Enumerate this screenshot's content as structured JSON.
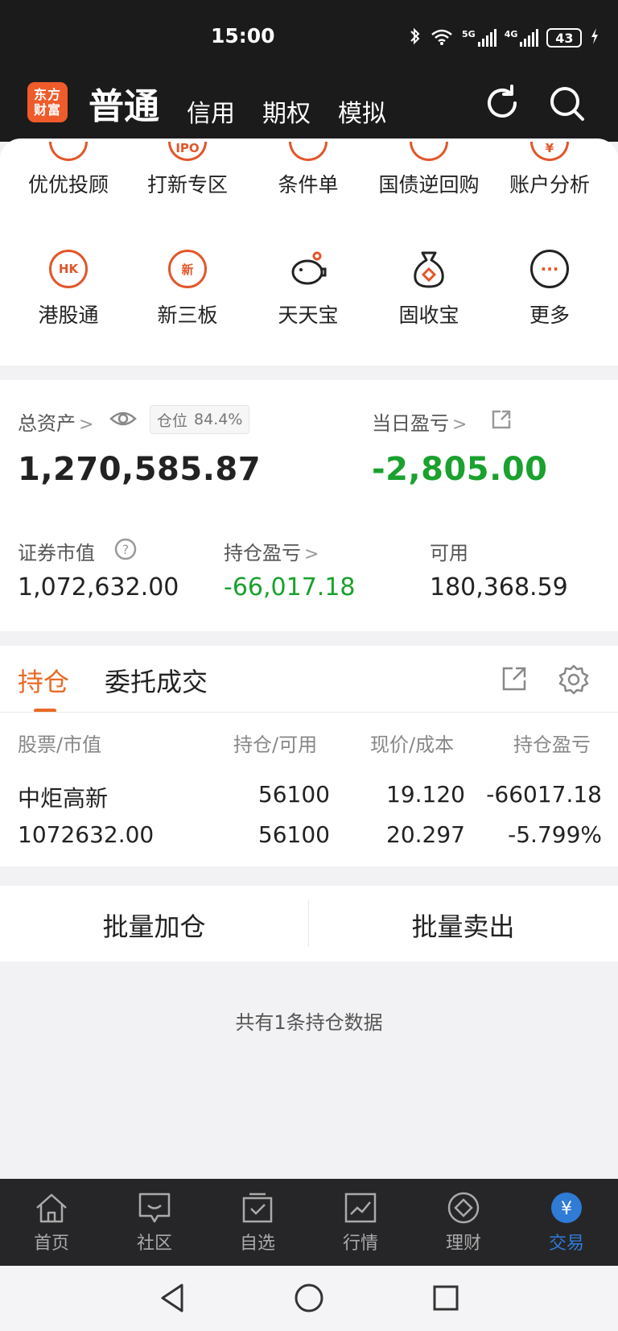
{
  "status_bar": {
    "time": "15:00",
    "battery": "43",
    "sig1": "5G",
    "sig2": "4G"
  },
  "header": {
    "logo_line1": "东方",
    "logo_line2": "财富",
    "tabs": [
      "普通",
      "信用",
      "期权",
      "模拟"
    ],
    "active_tab": "普通"
  },
  "quick_grid": {
    "row1": [
      {
        "label": "优优投顾",
        "icon": "clip-icon",
        "glyph": ""
      },
      {
        "label": "打新专区",
        "icon": "ipo-icon",
        "glyph": "IPO"
      },
      {
        "label": "条件单",
        "icon": "candlestick-icon",
        "glyph": ""
      },
      {
        "label": "国债逆回购",
        "icon": "repo-icon",
        "glyph": ""
      },
      {
        "label": "账户分析",
        "icon": "yen-chart-icon",
        "glyph": "¥"
      }
    ],
    "row2": [
      {
        "label": "港股通",
        "icon": "hk-icon",
        "glyph": "HK"
      },
      {
        "label": "新三板",
        "icon": "new-board-icon",
        "glyph": "新"
      },
      {
        "label": "天天宝",
        "icon": "piggy-bank-icon",
        "glyph": ""
      },
      {
        "label": "固收宝",
        "icon": "money-bag-icon",
        "glyph": ""
      },
      {
        "label": "更多",
        "icon": "more-icon",
        "glyph": "···"
      }
    ]
  },
  "assets": {
    "total_label": "总资产",
    "total_value": "1,270,585.87",
    "position_ratio_label": "仓位",
    "position_ratio_value": "84.4%",
    "daily_pl_label": "当日盈亏",
    "daily_pl_value": "-2,805.00",
    "market_value_label": "证券市值",
    "market_value": "1,072,632.00",
    "holding_pl_label": "持仓盈亏",
    "holding_pl_value": "-66,017.18",
    "available_label": "可用",
    "available_value": "180,368.59"
  },
  "holdings": {
    "tabs": [
      "持仓",
      "委托成交"
    ],
    "columns": [
      "股票/市值",
      "持仓/可用",
      "现价/成本",
      "持仓盈亏"
    ],
    "rows": [
      {
        "name": "中炬高新",
        "market_value": "1072632.00",
        "position": "56100",
        "available": "56100",
        "price": "19.120",
        "cost": "20.297",
        "pl": "-66017.18",
        "pl_pct": "-5.799%"
      }
    ]
  },
  "batch": {
    "add": "批量加仓",
    "sell": "批量卖出"
  },
  "holding_count_text": "共有1条持仓数据",
  "bottom_nav": [
    {
      "label": "首页",
      "icon": "home-icon"
    },
    {
      "label": "社区",
      "icon": "community-icon"
    },
    {
      "label": "自选",
      "icon": "watchlist-icon"
    },
    {
      "label": "行情",
      "icon": "market-icon"
    },
    {
      "label": "理财",
      "icon": "wealth-icon"
    },
    {
      "label": "交易",
      "icon": "trade-icon"
    }
  ],
  "colors": {
    "accent": "#e86b26",
    "loss": "#1aa12e",
    "nav_active": "#2f7bd6",
    "header_bg": "#1b1b1c"
  }
}
